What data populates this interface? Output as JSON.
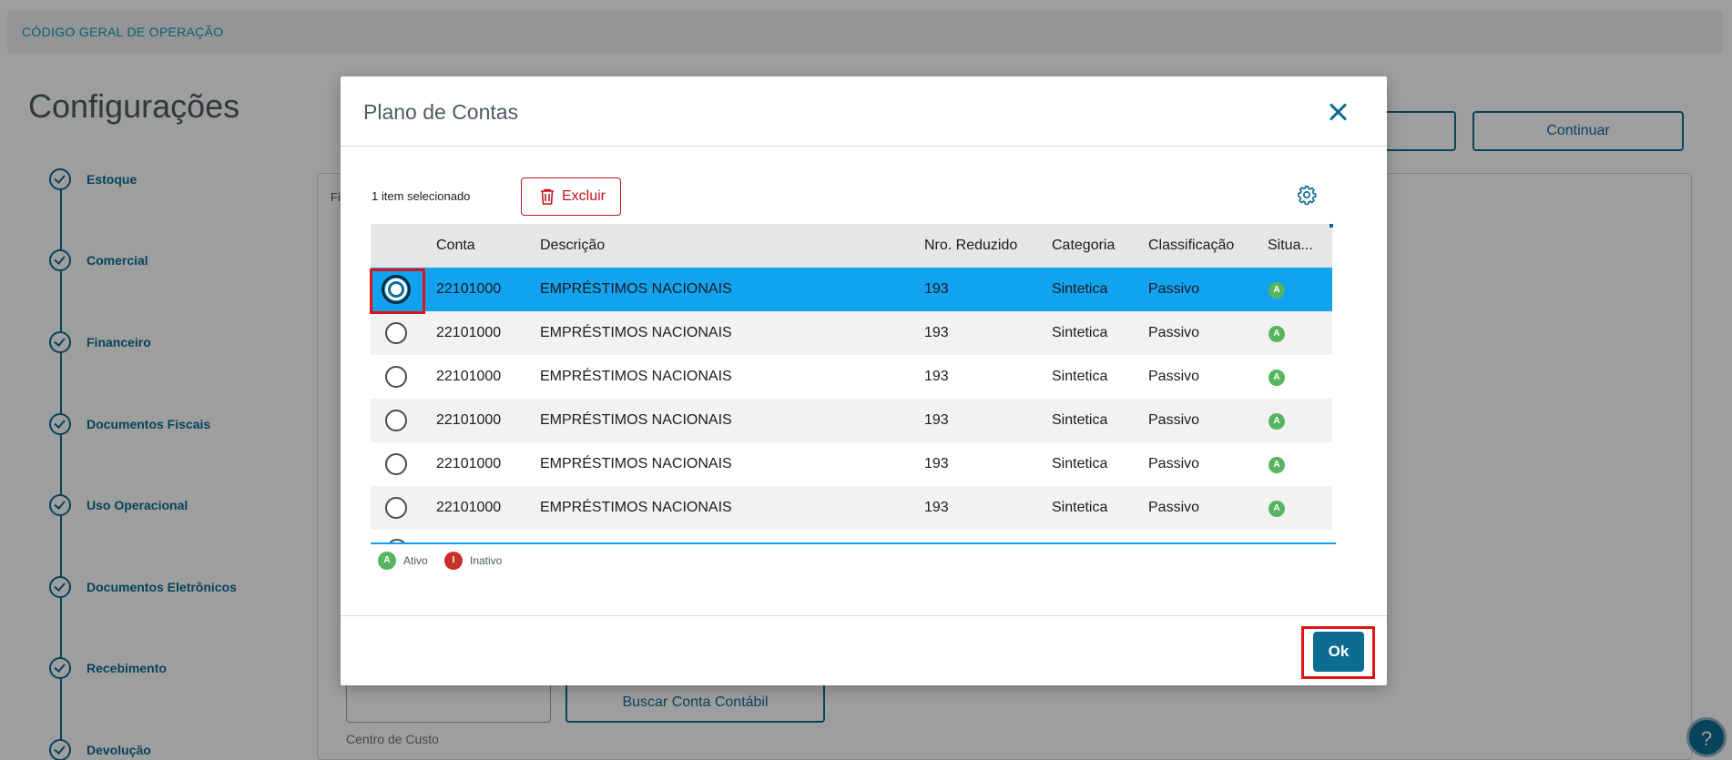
{
  "topbar": {
    "breadcrumb": "CÓDIGO GERAL DE OPERAÇÃO"
  },
  "page": {
    "title": "Configurações",
    "continue_label": "Continuar",
    "content_prefix": "Fi",
    "search_account_label": "Buscar Conta Contábil",
    "cost_center_label": "Centro de Custo",
    "help_icon": "?"
  },
  "stepper": {
    "steps": [
      {
        "label": "Estoque"
      },
      {
        "label": "Comercial"
      },
      {
        "label": "Financeiro"
      },
      {
        "label": "Documentos Fiscais"
      },
      {
        "label": "Uso Operacional"
      },
      {
        "label": "Documentos Eletrônicos"
      },
      {
        "label": "Recebimento"
      },
      {
        "label": "Devolução"
      }
    ]
  },
  "modal": {
    "title": "Plano de Contas",
    "selection_text": "1 item selecionado",
    "delete_label": "Excluir",
    "ok_label": "Ok",
    "columns": [
      "Conta",
      "Descrição",
      "Nro. Reduzido",
      "Categoria",
      "Classificação",
      "Situa..."
    ],
    "rows": [
      {
        "conta": "22101000",
        "descricao": "EMPRÉSTIMOS NACIONAIS",
        "nro_reduzido": "193",
        "categoria": "Sintetica",
        "classificacao": "Passivo",
        "situacao": "A",
        "selected": true
      },
      {
        "conta": "22101000",
        "descricao": "EMPRÉSTIMOS NACIONAIS",
        "nro_reduzido": "193",
        "categoria": "Sintetica",
        "classificacao": "Passivo",
        "situacao": "A",
        "selected": false
      },
      {
        "conta": "22101000",
        "descricao": "EMPRÉSTIMOS NACIONAIS",
        "nro_reduzido": "193",
        "categoria": "Sintetica",
        "classificacao": "Passivo",
        "situacao": "A",
        "selected": false
      },
      {
        "conta": "22101000",
        "descricao": "EMPRÉSTIMOS NACIONAIS",
        "nro_reduzido": "193",
        "categoria": "Sintetica",
        "classificacao": "Passivo",
        "situacao": "A",
        "selected": false
      },
      {
        "conta": "22101000",
        "descricao": "EMPRÉSTIMOS NACIONAIS",
        "nro_reduzido": "193",
        "categoria": "Sintetica",
        "classificacao": "Passivo",
        "situacao": "A",
        "selected": false
      },
      {
        "conta": "22101000",
        "descricao": "EMPRÉSTIMOS NACIONAIS",
        "nro_reduzido": "193",
        "categoria": "Sintetica",
        "classificacao": "Passivo",
        "situacao": "A",
        "selected": false
      }
    ],
    "legend": [
      {
        "badge": "A",
        "label": "Ativo",
        "color": "#57b560"
      },
      {
        "badge": "I",
        "label": "Inativo",
        "color": "#c9302c"
      }
    ]
  },
  "colors": {
    "primary": "#0c6c94",
    "selected_row": "#12a3f0",
    "danger": "#c0131b",
    "highlight": "#e01414"
  }
}
